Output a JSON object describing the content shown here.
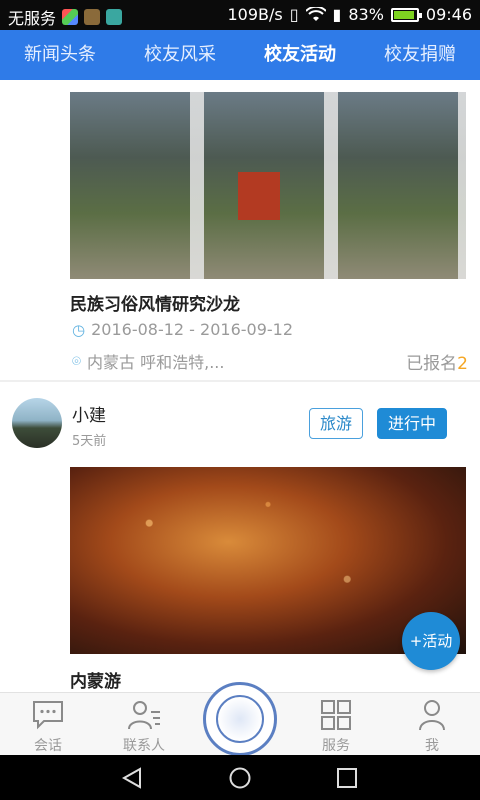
{
  "status_bar": {
    "carrier": "无服务",
    "speed": "109B/s",
    "battery": "83%",
    "battery_level": 0.83,
    "time": "09:46"
  },
  "tabs": [
    {
      "label": "新闻头条",
      "active": false
    },
    {
      "label": "校友风采",
      "active": false
    },
    {
      "label": "校友活动",
      "active": true
    },
    {
      "label": "校友捐赠",
      "active": false
    }
  ],
  "feed": {
    "item1": {
      "title": "民族习俗风情研究沙龙",
      "date_range": "2016-08-12 - 2016-09-12",
      "location": "内蒙古 呼和浩特,...",
      "signup_label": "已报名",
      "signup_count": "2"
    },
    "item2": {
      "user_name": "小建",
      "time_ago": "5天前",
      "tag_category": "旅游",
      "tag_status": "进行中",
      "title": "内蒙游"
    },
    "fab_label": "+活动"
  },
  "bottom_nav": [
    {
      "label": "会话",
      "icon": "chat-icon"
    },
    {
      "label": "联系人",
      "icon": "contacts-icon"
    },
    {
      "label": "",
      "icon": "university-logo"
    },
    {
      "label": "服务",
      "icon": "services-grid-icon"
    },
    {
      "label": "我",
      "icon": "person-icon"
    }
  ],
  "colors": {
    "brand_blue": "#2f7be8",
    "accent_blue": "#1f8bd6",
    "count_orange": "#f5a623"
  }
}
